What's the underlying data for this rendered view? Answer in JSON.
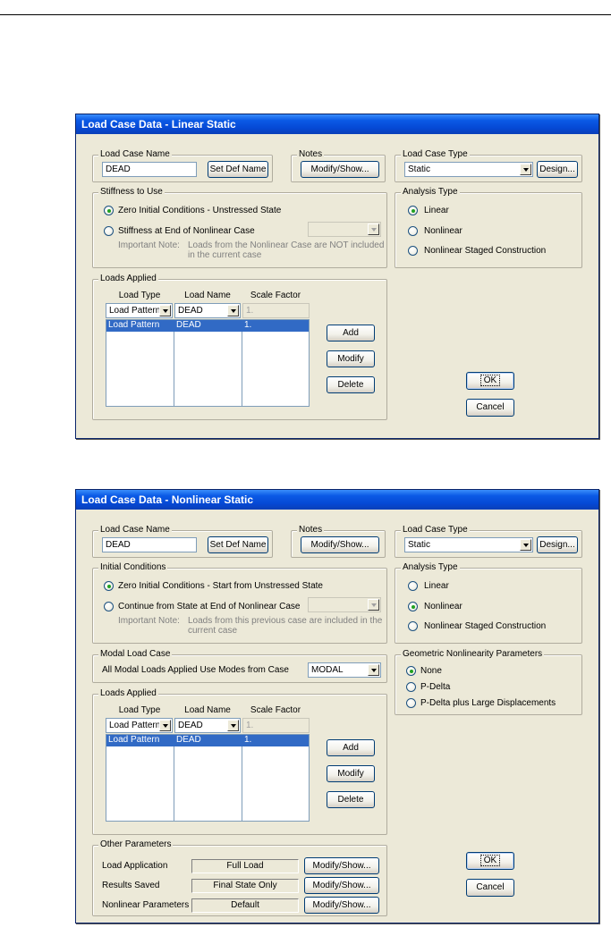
{
  "dialog1": {
    "title": "Load Case Data - Linear Static",
    "load_case_name": {
      "legend": "Load Case Name",
      "value": "DEAD",
      "button": "Set Def Name"
    },
    "notes": {
      "legend": "Notes",
      "button": "Modify/Show..."
    },
    "load_case_type": {
      "legend": "Load Case Type",
      "value": "Static",
      "button": "Design..."
    },
    "stiffness": {
      "legend": "Stiffness to Use",
      "option1": "Zero Initial Conditions - Unstressed State",
      "option2": "Stiffness at End of Nonlinear Case",
      "note_label": "Important Note:",
      "note_line1": "Loads from the Nonlinear Case are NOT included",
      "note_line2": "in the current case"
    },
    "analysis_type": {
      "legend": "Analysis Type",
      "option1": "Linear",
      "option2": "Nonlinear",
      "option3": "Nonlinear Staged Construction",
      "selected": "Linear"
    },
    "loads_applied": {
      "legend": "Loads Applied",
      "headers": [
        "Load Type",
        "Load Name",
        "Scale Factor"
      ],
      "edit_row": [
        "Load Pattern",
        "DEAD",
        "1."
      ],
      "rows": [
        [
          "Load Pattern",
          "DEAD",
          "1."
        ]
      ],
      "add": "Add",
      "modify": "Modify",
      "delete": "Delete"
    },
    "ok": "OK",
    "cancel": "Cancel"
  },
  "dialog2": {
    "title": "Load Case Data - Nonlinear Static",
    "load_case_name": {
      "legend": "Load Case Name",
      "value": "DEAD",
      "button": "Set Def Name"
    },
    "notes": {
      "legend": "Notes",
      "button": "Modify/Show..."
    },
    "load_case_type": {
      "legend": "Load Case Type",
      "value": "Static",
      "button": "Design..."
    },
    "initial_conditions": {
      "legend": "Initial Conditions",
      "option1": "Zero Initial Conditions - Start from Unstressed State",
      "option2": "Continue from State at End of Nonlinear Case",
      "note_label": "Important Note:",
      "note_line1": "Loads from this previous case are included in the",
      "note_line2": "current case"
    },
    "analysis_type": {
      "legend": "Analysis Type",
      "option1": "Linear",
      "option2": "Nonlinear",
      "option3": "Nonlinear Staged Construction",
      "selected": "Nonlinear"
    },
    "modal_load_case": {
      "legend": "Modal Load Case",
      "label": "All Modal Loads Applied Use Modes from Case",
      "value": "MODAL"
    },
    "geometric_nonlinearity": {
      "legend": "Geometric Nonlinearity Parameters",
      "option1": "None",
      "option2": "P-Delta",
      "option3": "P-Delta plus Large Displacements",
      "selected": "None"
    },
    "loads_applied": {
      "legend": "Loads Applied",
      "headers": [
        "Load Type",
        "Load Name",
        "Scale Factor"
      ],
      "edit_row": [
        "Load Pattern",
        "DEAD",
        "1."
      ],
      "rows": [
        [
          "Load Pattern",
          "DEAD",
          "1."
        ]
      ],
      "add": "Add",
      "modify": "Modify",
      "delete": "Delete"
    },
    "other_parameters": {
      "legend": "Other Parameters",
      "rows": [
        {
          "label": "Load Application",
          "value": "Full Load",
          "button": "Modify/Show..."
        },
        {
          "label": "Results Saved",
          "value": "Final State Only",
          "button": "Modify/Show..."
        },
        {
          "label": "Nonlinear Parameters",
          "value": "Default",
          "button": "Modify/Show..."
        }
      ]
    },
    "ok": "OK",
    "cancel": "Cancel"
  }
}
